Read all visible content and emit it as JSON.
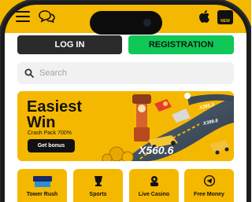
{
  "header": {
    "menu_icon": "hamburger-menu-icon",
    "chat_icon": "chat-bubbles-icon",
    "apple_icon": "apple-icon",
    "badge_text": "NEW"
  },
  "auth": {
    "login_label": "LOG IN",
    "registration_label": "REGISTRATION"
  },
  "search": {
    "placeholder": "Search",
    "icon": "search-icon"
  },
  "banner": {
    "title_line1": "Easiest",
    "title_line2": "Win",
    "subtitle": "Crash Pack 700%",
    "button_label": "Get bonus",
    "multipliers": [
      "X560.6",
      "X285.3",
      "X399.8"
    ]
  },
  "categories": [
    {
      "label": "Tower Rush",
      "icon": "tower-rush-logo-icon",
      "logo_text": "TOWER RUSH"
    },
    {
      "label": "Sports",
      "icon": "sports-icon"
    },
    {
      "label": "Live Casino",
      "icon": "live-casino-icon"
    },
    {
      "label": "Free Money",
      "icon": "telegram-icon"
    }
  ],
  "colors": {
    "brand_yellow": "#f5b800",
    "registration_green": "#10c857",
    "dark": "#2b2b2b"
  }
}
